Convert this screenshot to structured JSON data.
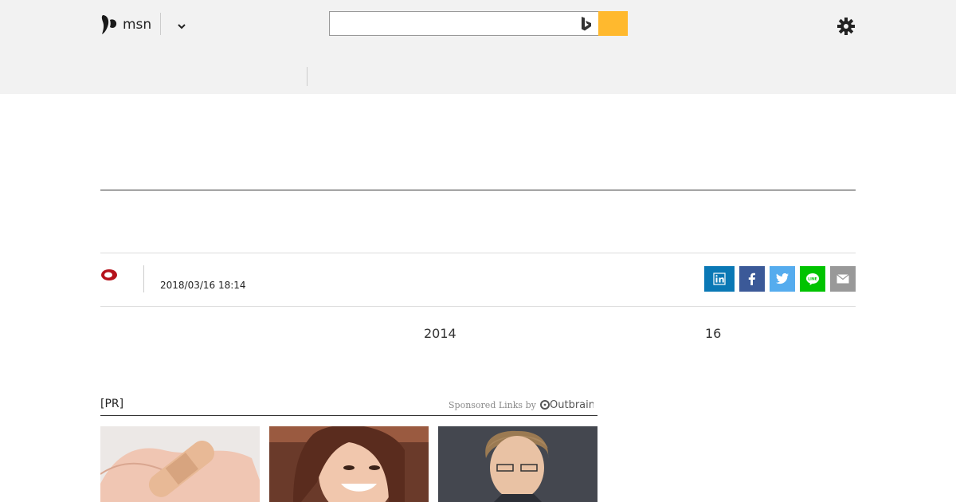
{
  "header": {
    "logo_text": "msn",
    "search_placeholder": "",
    "search_value": ""
  },
  "article": {
    "timestamp": "2018/03/16 18:14",
    "body_fragments": [
      "2014",
      "16"
    ]
  },
  "share": {
    "linkedin": "linkedin-icon",
    "facebook": "facebook-icon",
    "twitter": "twitter-icon",
    "line": "line-icon",
    "mail": "mail-icon"
  },
  "sponsored": {
    "pr_label": "[PR]",
    "links_text": "Sponsored Links by",
    "provider": "Outbrain"
  },
  "colors": {
    "search_button": "#ffb92e",
    "linkedin": "#0a78b5",
    "facebook": "#3b5998",
    "twitter": "#55acee",
    "line": "#00c300",
    "mail": "#999999"
  }
}
